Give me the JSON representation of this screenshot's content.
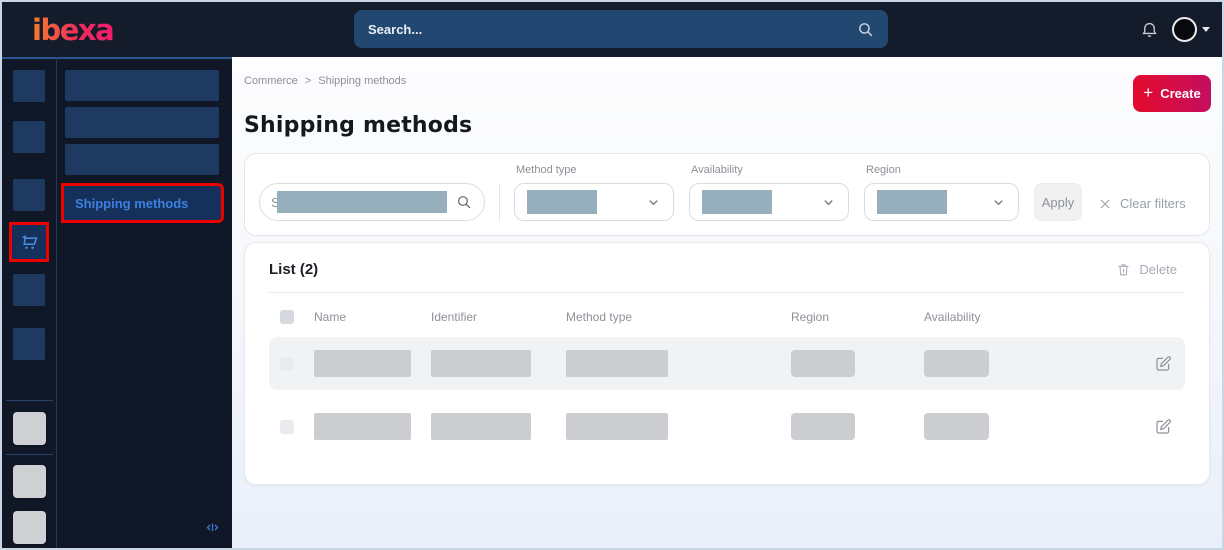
{
  "topbar": {
    "logo_text": "ibexa",
    "search_placeholder": "Search..."
  },
  "sidebar": {
    "active_icon": "commerce-cart",
    "annotation_color": "#ec0000"
  },
  "menu": {
    "active_item_label": "Shipping methods"
  },
  "main": {
    "breadcrumb": {
      "items": [
        "Commerce",
        "Shipping methods"
      ],
      "separator": ">"
    },
    "title": "Shipping methods",
    "create_button_label": "Create",
    "create_button_plus": "+",
    "filters": {
      "search_peek_text": "S",
      "fields": [
        {
          "label": "Method type"
        },
        {
          "label": "Availability"
        },
        {
          "label": "Region"
        }
      ],
      "apply_label": "Apply",
      "clear_filters_label": "Clear filters"
    },
    "list": {
      "title": "List (2)",
      "delete_label": "Delete",
      "columns": [
        "Name",
        "Identifier",
        "Method type",
        "Region",
        "Availability"
      ],
      "row_count": 2
    }
  },
  "colors": {
    "topbar_bg": "#141c2b",
    "sidebar_bg": "#101828",
    "sidebar_tile_blue": "#1e3a61",
    "active_link_blue": "#3d80e0",
    "annotation_red": "#ec0000",
    "create_gradient": [
      "#e30b2d",
      "#c40f5f"
    ],
    "redaction_blue": "#97afbd",
    "redaction_gray": "#cbcdd0"
  }
}
